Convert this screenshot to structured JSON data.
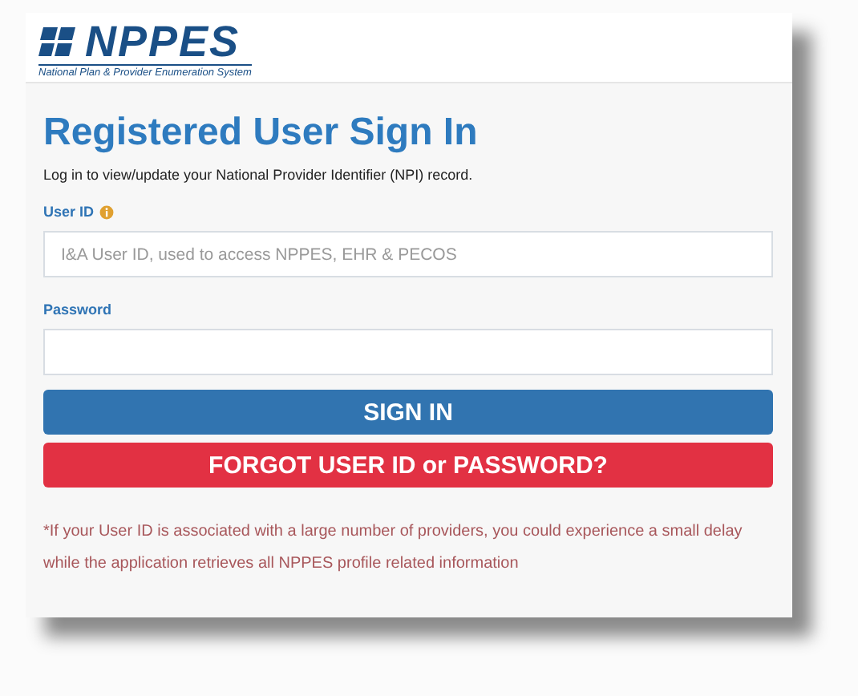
{
  "header": {
    "logo_text": "NPPES",
    "logo_subtitle": "National Plan & Provider Enumeration System"
  },
  "title": "Registered User Sign In",
  "intro": "Log in to view/update your National Provider Identifier (NPI) record.",
  "fields": [
    {
      "label": "User ID",
      "info": true,
      "placeholder": "I&A User ID, used to access NPPES, EHR & PECOS"
    },
    {
      "label": "Password",
      "info": false
    }
  ],
  "buttons": [
    {
      "label": "SIGN IN",
      "kind": "primary"
    },
    {
      "label": "FORGOT USER ID or PASSWORD?",
      "kind": "danger"
    }
  ],
  "note": "*If your User ID is associated with a large number of providers, you could experience a small delay while the application retrieves all NPPES profile related information"
}
